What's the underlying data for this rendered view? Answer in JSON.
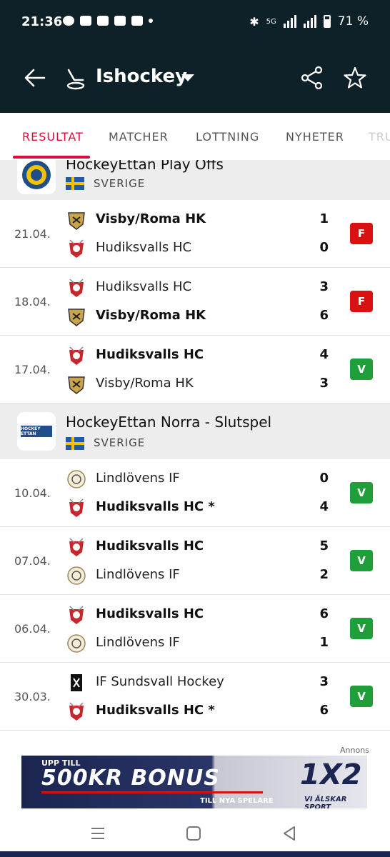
{
  "status_bar": {
    "time": "21:36",
    "network": "5G",
    "battery": "71 %"
  },
  "app_bar": {
    "title": "Ishockey"
  },
  "tabs": [
    {
      "label": "RESULTAT",
      "active": true
    },
    {
      "label": "MATCHER"
    },
    {
      "label": "LOTTNING"
    },
    {
      "label": "NYHETER"
    },
    {
      "label": "TRU"
    }
  ],
  "leagues": [
    {
      "name": "HockeyEttan Play Offs",
      "country": "SVERIGE",
      "matches": [
        {
          "date": "21.04.",
          "home": {
            "name": "Visby/Roma HK",
            "score": "1",
            "bold": true
          },
          "away": {
            "name": "Hudiksvalls HC",
            "score": "0",
            "bold": false
          },
          "result": "F"
        },
        {
          "date": "18.04.",
          "home": {
            "name": "Hudiksvalls HC",
            "score": "3",
            "bold": false
          },
          "away": {
            "name": "Visby/Roma HK",
            "score": "6",
            "bold": true
          },
          "result": "F"
        },
        {
          "date": "17.04.",
          "home": {
            "name": "Hudiksvalls HC",
            "score": "4",
            "bold": true
          },
          "away": {
            "name": "Visby/Roma HK",
            "score": "3",
            "bold": false
          },
          "result": "V"
        }
      ]
    },
    {
      "name": "HockeyEttan Norra - Slutspel",
      "country": "SVERIGE",
      "logo_text": "HOCKEY ETTAN",
      "matches": [
        {
          "date": "10.04.",
          "home": {
            "name": "Lindlövens IF",
            "score": "0",
            "bold": false
          },
          "away": {
            "name": "Hudiksvalls HC *",
            "score": "4",
            "bold": true
          },
          "result": "V"
        },
        {
          "date": "07.04.",
          "home": {
            "name": "Hudiksvalls HC",
            "score": "5",
            "bold": true
          },
          "away": {
            "name": "Lindlövens IF",
            "score": "2",
            "bold": false
          },
          "result": "V"
        },
        {
          "date": "06.04.",
          "home": {
            "name": "Hudiksvalls HC",
            "score": "6",
            "bold": true
          },
          "away": {
            "name": "Lindlövens IF",
            "score": "1",
            "bold": false
          },
          "result": "V"
        },
        {
          "date": "30.03.",
          "home": {
            "name": "IF Sundsvall Hockey",
            "score": "3",
            "bold": false
          },
          "away": {
            "name": "Hudiksvalls HC *",
            "score": "6",
            "bold": true
          },
          "result": "V"
        }
      ]
    }
  ],
  "ad": {
    "label": "Annons",
    "line1": "UPP TILL",
    "line2": "500KR BONUS",
    "line3": "TILL NYA SPELARE",
    "brand": "1X2",
    "tagline": "VI ÄLSKAR SPORT"
  }
}
